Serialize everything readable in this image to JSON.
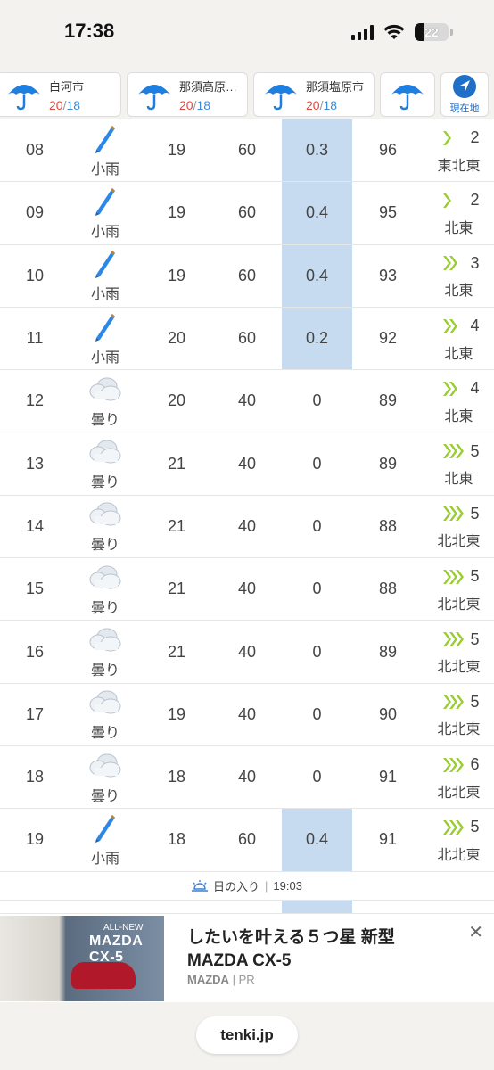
{
  "status_bar": {
    "time": "17:38",
    "battery": "22"
  },
  "locations": [
    {
      "name": "白河市",
      "high": "20",
      "low": "18",
      "sep": "/",
      "icon": "umbrella-icon"
    },
    {
      "name": "那須高原…",
      "high": "20",
      "low": "18",
      "sep": "/",
      "icon": "umbrella-icon"
    },
    {
      "name": "那須塩原市",
      "high": "20",
      "low": "18",
      "sep": "/",
      "icon": "umbrella-icon"
    }
  ],
  "current_location": {
    "label": "現在地"
  },
  "rows": [
    {
      "hour": "08",
      "weather": "小雨",
      "icon": "umbrella-closed-icon",
      "temp": "19",
      "prob": "60",
      "precip": "0.3",
      "humidity": "96",
      "wind_speed": "2",
      "wind_dir": "東北東"
    },
    {
      "hour": "09",
      "weather": "小雨",
      "icon": "umbrella-closed-icon",
      "temp": "19",
      "prob": "60",
      "precip": "0.4",
      "humidity": "95",
      "wind_speed": "2",
      "wind_dir": "北東"
    },
    {
      "hour": "10",
      "weather": "小雨",
      "icon": "umbrella-closed-icon",
      "temp": "19",
      "prob": "60",
      "precip": "0.4",
      "humidity": "93",
      "wind_speed": "3",
      "wind_dir": "北東"
    },
    {
      "hour": "11",
      "weather": "小雨",
      "icon": "umbrella-closed-icon",
      "temp": "20",
      "prob": "60",
      "precip": "0.2",
      "humidity": "92",
      "wind_speed": "4",
      "wind_dir": "北東"
    },
    {
      "hour": "12",
      "weather": "曇り",
      "icon": "cloud-icon",
      "temp": "20",
      "prob": "40",
      "precip": "0",
      "humidity": "89",
      "wind_speed": "4",
      "wind_dir": "北東"
    },
    {
      "hour": "13",
      "weather": "曇り",
      "icon": "cloud-icon",
      "temp": "21",
      "prob": "40",
      "precip": "0",
      "humidity": "89",
      "wind_speed": "5",
      "wind_dir": "北東"
    },
    {
      "hour": "14",
      "weather": "曇り",
      "icon": "cloud-icon",
      "temp": "21",
      "prob": "40",
      "precip": "0",
      "humidity": "88",
      "wind_speed": "5",
      "wind_dir": "北北東"
    },
    {
      "hour": "15",
      "weather": "曇り",
      "icon": "cloud-icon",
      "temp": "21",
      "prob": "40",
      "precip": "0",
      "humidity": "88",
      "wind_speed": "5",
      "wind_dir": "北北東"
    },
    {
      "hour": "16",
      "weather": "曇り",
      "icon": "cloud-icon",
      "temp": "21",
      "prob": "40",
      "precip": "0",
      "humidity": "89",
      "wind_speed": "5",
      "wind_dir": "北北東"
    },
    {
      "hour": "17",
      "weather": "曇り",
      "icon": "cloud-icon",
      "temp": "19",
      "prob": "40",
      "precip": "0",
      "humidity": "90",
      "wind_speed": "5",
      "wind_dir": "北北東"
    },
    {
      "hour": "18",
      "weather": "曇り",
      "icon": "cloud-icon",
      "temp": "18",
      "prob": "40",
      "precip": "0",
      "humidity": "91",
      "wind_speed": "6",
      "wind_dir": "北北東"
    },
    {
      "hour": "19",
      "weather": "小雨",
      "icon": "umbrella-closed-icon",
      "temp": "18",
      "prob": "60",
      "precip": "0.4",
      "humidity": "91",
      "wind_speed": "5",
      "wind_dir": "北北東"
    }
  ],
  "sunset": {
    "label": "日の入り",
    "divider": "|",
    "time": "19:03"
  },
  "ad": {
    "image_tag": "ALL-NEW",
    "image_model": "MAZDA CX-5",
    "title": "したいを叶える５つ星 新型MAZDA CX-5",
    "brand": "MAZDA",
    "brand_sep": "|",
    "pr": "PR"
  },
  "url_bar": {
    "domain": "tenki.jp"
  },
  "colors": {
    "high": "#e0463c",
    "low": "#3b8ad8",
    "precip_bg": "#c6daf0",
    "wind_green": "#9acd32",
    "umbrella_blue": "#1f7fe0"
  }
}
